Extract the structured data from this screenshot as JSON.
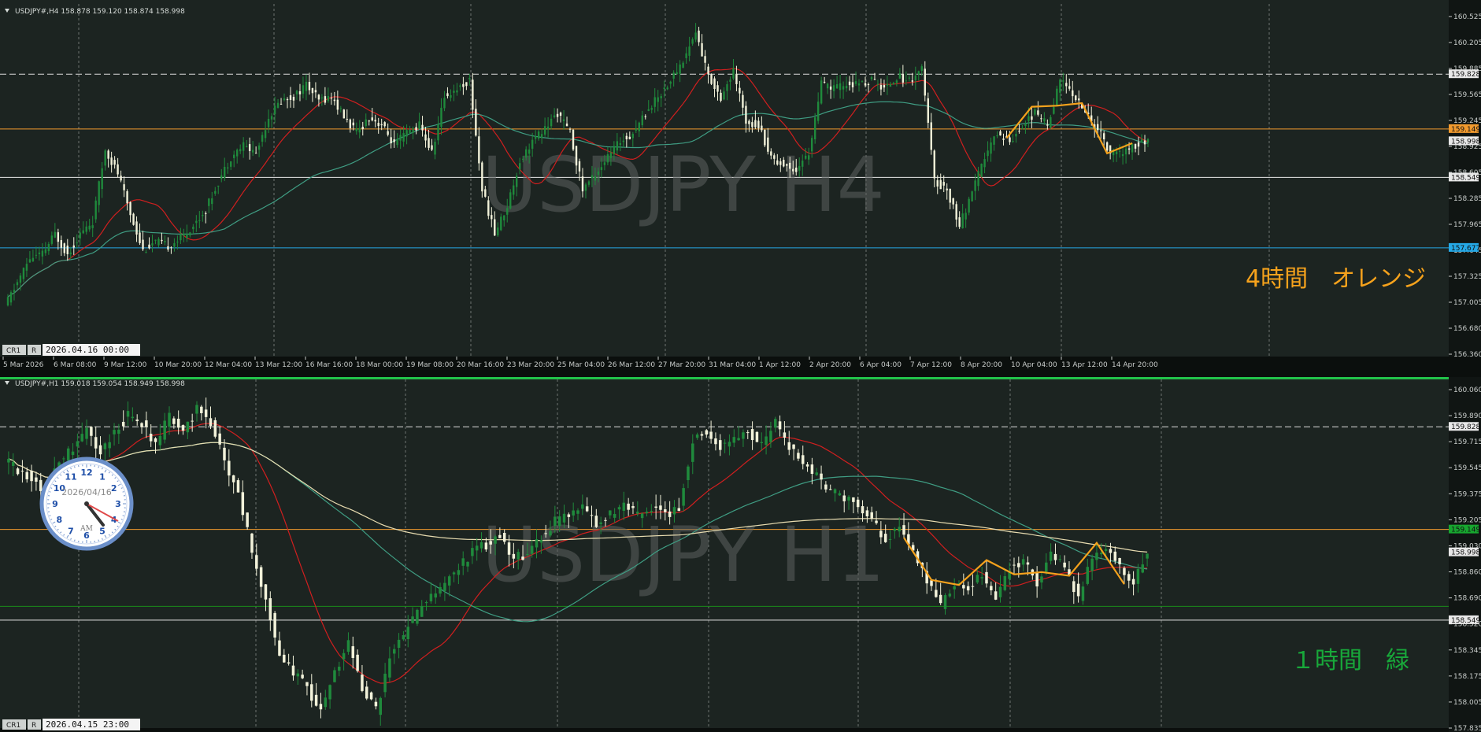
{
  "colors": {
    "background": "#1c2421",
    "grid": "#8a8f8c",
    "bull": "#1f8a3c",
    "bear": "#f2f2da",
    "ma_red": "#d11f1f",
    "ma_teal": "#3f9d83",
    "ma_cream": "#e8dcb0",
    "zigzag": "#f5a21c",
    "level_orange": "#f29a2e",
    "level_white": "#e8e8e8",
    "level_blue": "#25a8e6",
    "level_green": "#1a8a1a"
  },
  "top_panel": {
    "header": "USDJPY#,H4  158.878 159.120 158.874 158.998",
    "watermark": "USDJPY H4",
    "annotation": "4時間　オレンジ",
    "buttons": [
      "CR1",
      "R"
    ],
    "timestamp": "2026.04.16 00:00",
    "price_ticks": [
      "160.525",
      "160.205",
      "159.885",
      "159.565",
      "159.245",
      "158.925",
      "158.605",
      "158.285",
      "157.965",
      "157.645",
      "157.325",
      "157.005",
      "156.680",
      "156.360"
    ],
    "time_ticks": [
      "5 Mar 2026",
      "6 Mar 08:00",
      "9 Mar 12:00",
      "10 Mar 20:00",
      "12 Mar 04:00",
      "13 Mar 12:00",
      "16 Mar 16:00",
      "18 Mar 00:00",
      "19 Mar 08:00",
      "20 Mar 16:00",
      "23 Mar 20:00",
      "25 Mar 04:00",
      "26 Mar 12:00",
      "27 Mar 20:00",
      "31 Mar 04:00",
      "1 Apr 12:00",
      "2 Apr 20:00",
      "6 Apr 04:00",
      "7 Apr 12:00",
      "8 Apr 20:00",
      "10 Apr 04:00",
      "13 Apr 12:00",
      "14 Apr 20:00"
    ],
    "level_tags": [
      {
        "text": "159.828",
        "type": "dashed"
      },
      {
        "text": "159.149",
        "type": "orange"
      },
      {
        "text": "158.998",
        "type": "price"
      },
      {
        "text": "158.549",
        "type": "white"
      },
      {
        "text": "157.677",
        "type": "blue"
      }
    ]
  },
  "bottom_panel": {
    "header": "USDJPY#,H1  159.018 159.054 158.949 158.998",
    "watermark": "USDJPY H1",
    "annotation": "１時間　緑",
    "buttons": [
      "CR1",
      "R"
    ],
    "timestamp": "2026.04.15 23:00",
    "clock": {
      "date": "2026/04/16",
      "ampm": "AM"
    },
    "price_ticks": [
      "160.060",
      "159.890",
      "159.715",
      "159.545",
      "159.375",
      "159.205",
      "159.030",
      "158.860",
      "158.690",
      "158.520",
      "158.345",
      "158.175",
      "158.005",
      "157.835"
    ],
    "level_tags": [
      {
        "text": "159.828",
        "type": "dashed"
      },
      {
        "text": "159.149",
        "type": "green"
      },
      {
        "text": "158.998",
        "type": "price"
      },
      {
        "text": "158.549",
        "type": "white"
      }
    ]
  },
  "chart_data": [
    {
      "type": "candlestick",
      "title": "USDJPY#,H4",
      "ylim": [
        156.36,
        160.6
      ],
      "levels": [
        159.828,
        159.149,
        158.549,
        157.677
      ],
      "close_path": [
        156.95,
        157.25,
        157.55,
        157.6,
        157.85,
        157.6,
        157.85,
        158.0,
        158.9,
        158.6,
        158.1,
        157.65,
        157.75,
        157.7,
        157.8,
        157.95,
        158.15,
        158.5,
        158.8,
        158.95,
        158.85,
        159.3,
        159.5,
        159.55,
        159.7,
        159.5,
        159.55,
        159.3,
        159.1,
        159.3,
        159.2,
        158.95,
        159.1,
        159.2,
        158.85,
        159.55,
        159.65,
        159.75,
        158.4,
        157.85,
        158.2,
        158.75,
        159.0,
        159.15,
        159.35,
        159.1,
        158.4,
        158.6,
        158.8,
        159.0,
        159.1,
        159.35,
        159.55,
        159.75,
        160.0,
        160.35,
        159.8,
        159.55,
        159.85,
        159.25,
        159.2,
        158.8,
        158.7,
        158.65,
        158.85,
        159.7,
        159.65,
        159.7,
        159.7,
        159.75,
        159.65,
        159.8,
        159.75,
        159.9,
        158.5,
        158.4,
        157.95,
        158.35,
        158.8,
        159.1,
        159.0,
        159.2,
        159.35,
        159.2,
        159.75,
        159.6,
        159.35,
        159.15,
        158.85,
        158.85,
        158.95,
        159.0
      ]
    },
    {
      "type": "candlestick",
      "title": "USDJPY#,H1",
      "ylim": [
        157.835,
        160.1
      ],
      "levels": [
        159.828,
        159.149,
        158.549,
        158.64
      ],
      "close_path": [
        159.6,
        159.55,
        159.5,
        159.4,
        159.6,
        159.7,
        159.8,
        159.65,
        159.8,
        159.9,
        159.85,
        159.7,
        159.9,
        159.8,
        159.95,
        159.85,
        159.6,
        159.4,
        159.0,
        158.7,
        158.3,
        158.2,
        158.1,
        157.95,
        158.2,
        158.4,
        158.1,
        157.95,
        158.3,
        158.45,
        158.6,
        158.7,
        158.8,
        158.9,
        159.0,
        159.05,
        159.1,
        158.95,
        159.0,
        159.1,
        159.2,
        159.25,
        159.3,
        159.2,
        159.25,
        159.3,
        159.25,
        159.3,
        159.25,
        159.3,
        159.75,
        159.8,
        159.7,
        159.75,
        159.8,
        159.7,
        159.85,
        159.7,
        159.6,
        159.5,
        159.4,
        159.35,
        159.3,
        159.2,
        159.1,
        159.15,
        159.0,
        158.8,
        158.65,
        158.8,
        158.75,
        158.85,
        158.7,
        158.9,
        158.95,
        158.8,
        159.0,
        158.9,
        158.7,
        158.95,
        159.05,
        158.9,
        158.8,
        159.0
      ]
    }
  ]
}
